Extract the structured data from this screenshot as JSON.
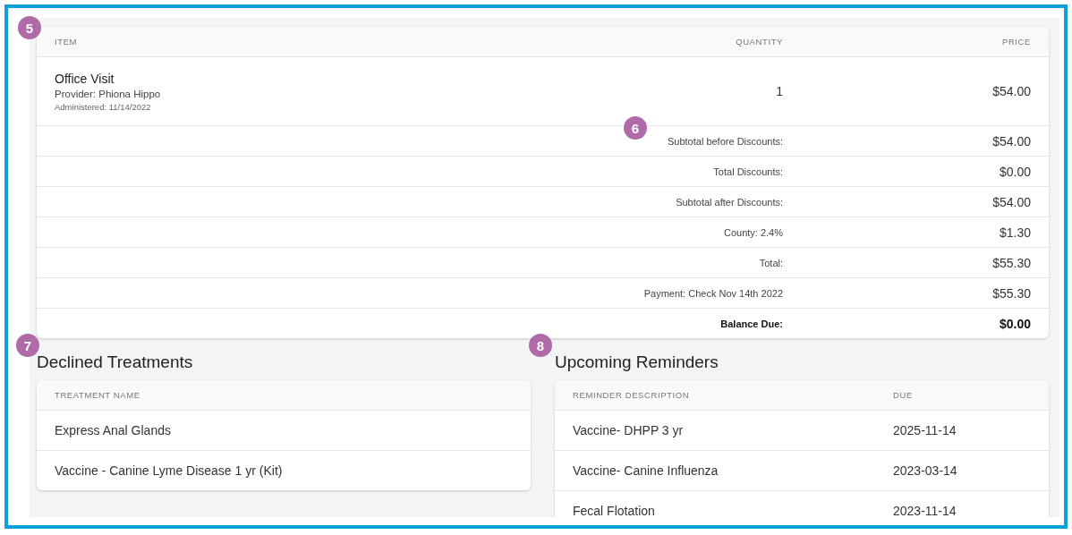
{
  "invoice": {
    "badge": "5",
    "columns": [
      "ITEM",
      "QUANTITY",
      "PRICE"
    ],
    "items": [
      {
        "name": "Office Visit",
        "provider": "Provider: Phiona Hippo",
        "administered": "Administered: 11/14/2022",
        "quantity": "1",
        "price": "$54.00"
      }
    ],
    "summary_badge": "6",
    "summary": [
      {
        "label": "Subtotal before Discounts:",
        "value": "$54.00",
        "emphasis": false
      },
      {
        "label": "Total Discounts:",
        "value": "$0.00",
        "emphasis": false
      },
      {
        "label": "Subtotal after Discounts:",
        "value": "$54.00",
        "emphasis": false
      },
      {
        "label": "County: 2.4%",
        "value": "$1.30",
        "emphasis": false
      },
      {
        "label": "Total:",
        "value": "$55.30",
        "emphasis": false
      },
      {
        "label": "Payment: Check Nov 14th 2022",
        "value": "$55.30",
        "emphasis": false
      },
      {
        "label": "Balance Due:",
        "value": "$0.00",
        "emphasis": true
      }
    ]
  },
  "declined_treatments": {
    "badge": "7",
    "title": "Declined Treatments",
    "columns": [
      "TREATMENT NAME"
    ],
    "rows": [
      [
        "Express Anal Glands"
      ],
      [
        "Vaccine - Canine Lyme Disease 1 yr (Kit)"
      ]
    ]
  },
  "upcoming_reminders": {
    "badge": "8",
    "title": "Upcoming Reminders",
    "columns": [
      "REMINDER DESCRIPTION",
      "DUE"
    ],
    "rows": [
      [
        "Vaccine- DHPP 3 yr",
        "2025-11-14"
      ],
      [
        "Vaccine- Canine Influenza",
        "2023-03-14"
      ],
      [
        "Fecal Flotation",
        "2023-11-14"
      ]
    ]
  }
}
